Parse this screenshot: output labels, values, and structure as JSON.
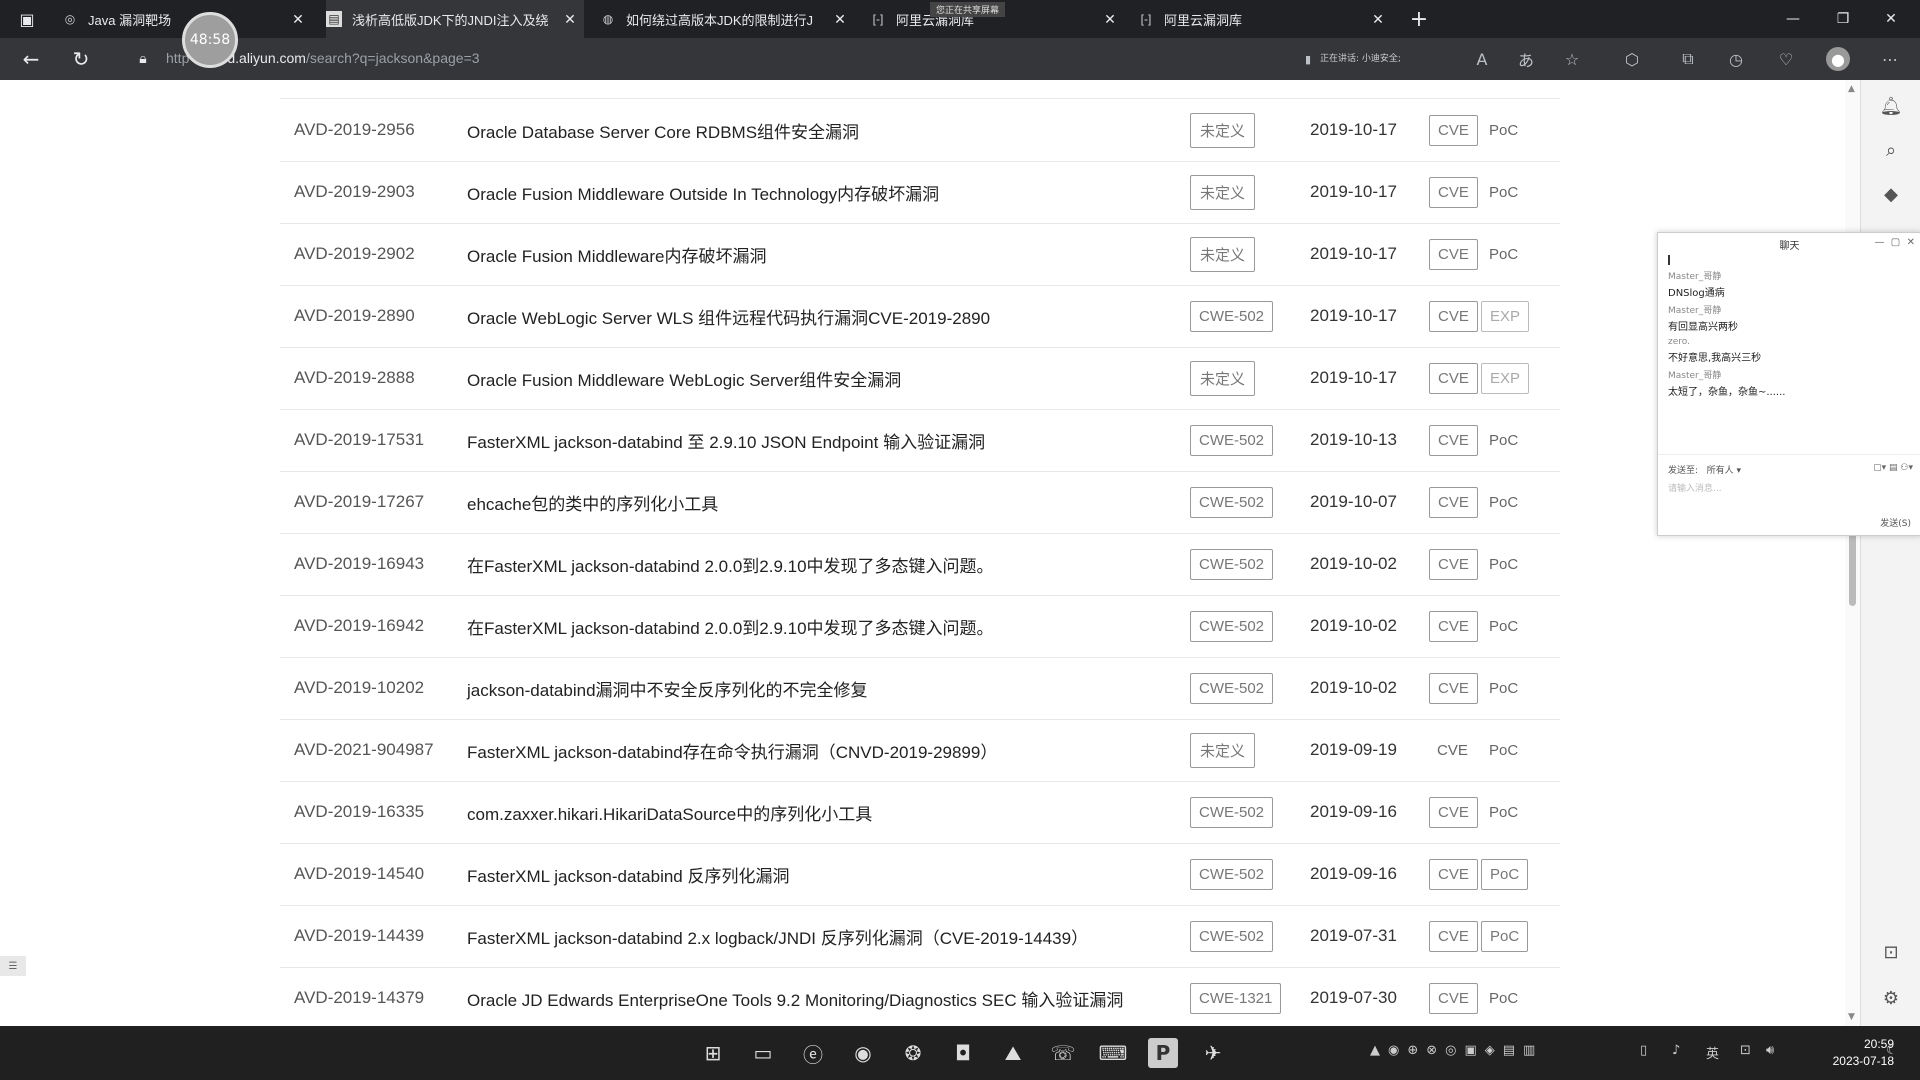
{
  "browser": {
    "tabs": [
      {
        "title": "Java 漏洞靶场",
        "icon": "app-icon"
      },
      {
        "title": "浅析高低版JDK下的JNDI注入及绕",
        "icon": "doc-icon"
      },
      {
        "title": "如何绕过高版本JDK的限制进行J",
        "icon": "globe-icon"
      },
      {
        "title": "阿里云漏洞库",
        "icon": "bracket-icon"
      },
      {
        "title": "阿里云漏洞库",
        "icon": "bracket-icon"
      }
    ],
    "overlay_banner": "您正在共享屏幕",
    "url_prefix": "http",
    "url_host": "d.aliyun.com",
    "url_path": "/search?q=jackson&page=3",
    "sharing_text": "正在讲话: 小迪安全;",
    "recording_timer": "48:58"
  },
  "rows": [
    {
      "id": "AVD-2019-2956",
      "title": "Oracle Database Server Core RDBMS组件安全漏洞",
      "cwe": "未定义",
      "date": "2019-10-17",
      "cve": "CVE",
      "poc": "PoC",
      "cve_boxed": true,
      "poc_boxed": false
    },
    {
      "id": "AVD-2019-2903",
      "title": "Oracle Fusion Middleware Outside In Technology内存破坏漏洞",
      "cwe": "未定义",
      "date": "2019-10-17",
      "cve": "CVE",
      "poc": "PoC",
      "cve_boxed": true,
      "poc_boxed": false
    },
    {
      "id": "AVD-2019-2902",
      "title": "Oracle Fusion Middleware内存破坏漏洞",
      "cwe": "未定义",
      "date": "2019-10-17",
      "cve": "CVE",
      "poc": "PoC",
      "cve_boxed": true,
      "poc_boxed": false
    },
    {
      "id": "AVD-2019-2890",
      "title": "Oracle WebLogic Server WLS 组件远程代码执行漏洞CVE-2019-2890",
      "cwe": "CWE-502",
      "date": "2019-10-17",
      "cve": "CVE",
      "poc": "EXP",
      "cve_boxed": true,
      "poc_boxed": true
    },
    {
      "id": "AVD-2019-2888",
      "title": "Oracle Fusion Middleware WebLogic Server组件安全漏洞",
      "cwe": "未定义",
      "date": "2019-10-17",
      "cve": "CVE",
      "poc": "EXP",
      "cve_boxed": true,
      "poc_boxed": true
    },
    {
      "id": "AVD-2019-17531",
      "title": "FasterXML jackson-databind 至 2.9.10 JSON Endpoint 输入验证漏洞",
      "cwe": "CWE-502",
      "date": "2019-10-13",
      "cve": "CVE",
      "poc": "PoC",
      "cve_boxed": true,
      "poc_boxed": false
    },
    {
      "id": "AVD-2019-17267",
      "title": "ehcache包的类中的序列化小工具",
      "cwe": "CWE-502",
      "date": "2019-10-07",
      "cve": "CVE",
      "poc": "PoC",
      "cve_boxed": true,
      "poc_boxed": false
    },
    {
      "id": "AVD-2019-16943",
      "title": "在FasterXML jackson-databind 2.0.0到2.9.10中发现了多态键入问题。",
      "cwe": "CWE-502",
      "date": "2019-10-02",
      "cve": "CVE",
      "poc": "PoC",
      "cve_boxed": true,
      "poc_boxed": false
    },
    {
      "id": "AVD-2019-16942",
      "title": "在FasterXML jackson-databind 2.0.0到2.9.10中发现了多态键入问题。",
      "cwe": "CWE-502",
      "date": "2019-10-02",
      "cve": "CVE",
      "poc": "PoC",
      "cve_boxed": true,
      "poc_boxed": false
    },
    {
      "id": "AVD-2019-10202",
      "title": "jackson-databind漏洞中不安全反序列化的不完全修复",
      "cwe": "CWE-502",
      "date": "2019-10-02",
      "cve": "CVE",
      "poc": "PoC",
      "cve_boxed": true,
      "poc_boxed": false
    },
    {
      "id": "AVD-2021-904987",
      "title": "FasterXML jackson-databind存在命令执行漏洞（CNVD-2019-29899）",
      "cwe": "未定义",
      "date": "2019-09-19",
      "cve": "CVE",
      "poc": "PoC",
      "cve_boxed": false,
      "poc_boxed": false
    },
    {
      "id": "AVD-2019-16335",
      "title": "com.zaxxer.hikari.HikariDataSource中的序列化小工具",
      "cwe": "CWE-502",
      "date": "2019-09-16",
      "cve": "CVE",
      "poc": "PoC",
      "cve_boxed": true,
      "poc_boxed": false
    },
    {
      "id": "AVD-2019-14540",
      "title": "FasterXML jackson-databind 反序列化漏洞",
      "cwe": "CWE-502",
      "date": "2019-09-16",
      "cve": "CVE",
      "poc": "PoC",
      "cve_boxed": true,
      "poc_boxed": true
    },
    {
      "id": "AVD-2019-14439",
      "title": "FasterXML jackson-databind 2.x logback/JNDI 反序列化漏洞（CVE-2019-14439）",
      "cwe": "CWE-502",
      "date": "2019-07-31",
      "cve": "CVE",
      "poc": "PoC",
      "cve_boxed": true,
      "poc_boxed": true
    },
    {
      "id": "AVD-2019-14379",
      "title": "Oracle JD Edwards EnterpriseOne Tools 9.2 Monitoring/Diagnostics SEC 输入验证漏洞",
      "cwe": "CWE-1321",
      "date": "2019-07-30",
      "cve": "CVE",
      "poc": "PoC",
      "cve_boxed": true,
      "poc_boxed": false
    }
  ],
  "chat": {
    "title": "聊天",
    "messages": [
      {
        "name": "Master_哥静",
        "text": "DNSlog通病"
      },
      {
        "name": "Master_哥静",
        "text": "有回显高兴两秒"
      },
      {
        "name": "zero.",
        "text": "不好意思,我高兴三秒"
      },
      {
        "name": "Master_哥静",
        "text": "太短了，杂鱼，杂鱼~......"
      }
    ],
    "to_label": "发送至:",
    "to_value": "所有人",
    "placeholder": "请输入消息...",
    "send_label": "发送(S)"
  },
  "taskbar": {
    "time": "20:59",
    "date": "2023-07-18",
    "ime": "英"
  }
}
